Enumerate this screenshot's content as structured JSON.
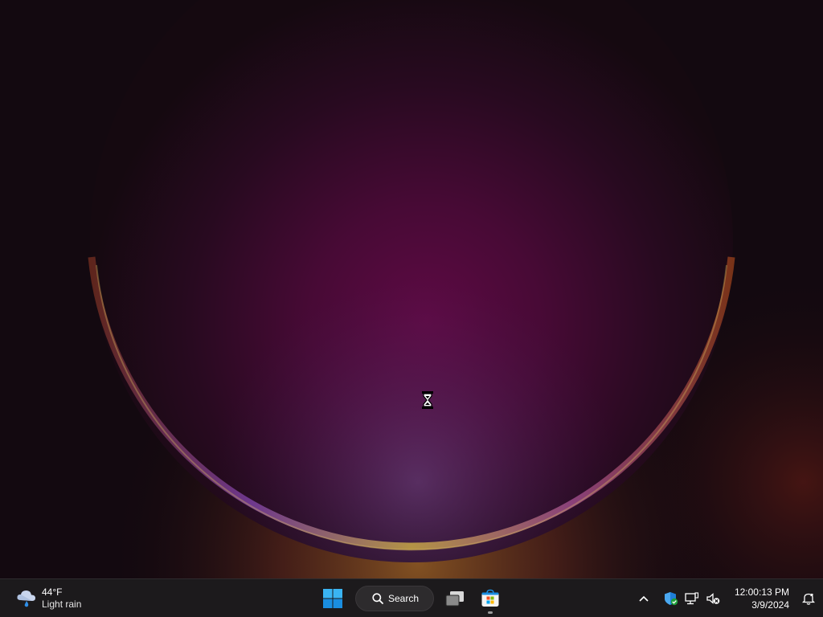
{
  "taskbar": {
    "weather": {
      "temperature": "44°F",
      "condition": "Light rain",
      "icon": "cloud-rain-icon"
    },
    "start": {
      "icon": "windows-logo-icon"
    },
    "search": {
      "label": "Search",
      "icon": "search-icon"
    },
    "pinned": [
      {
        "name": "task-view",
        "icon": "task-view-icon"
      },
      {
        "name": "microsoft-store",
        "icon": "store-icon",
        "running": true
      }
    ],
    "tray": {
      "overflow_icon": "chevron-up-icon",
      "icons": [
        "windows-security-icon",
        "network-icon",
        "volume-muted-icon"
      ]
    },
    "clock": {
      "time": "12:00:13 PM",
      "date": "3/9/2024"
    },
    "notifications": {
      "icon": "notification-bell-icon"
    }
  },
  "desktop": {
    "cursor": "busy-hourglass-cursor"
  },
  "colors": {
    "accent": "#0078d4",
    "taskbar_bg": "#1c1a1c",
    "wallpaper_base": "#130910"
  }
}
